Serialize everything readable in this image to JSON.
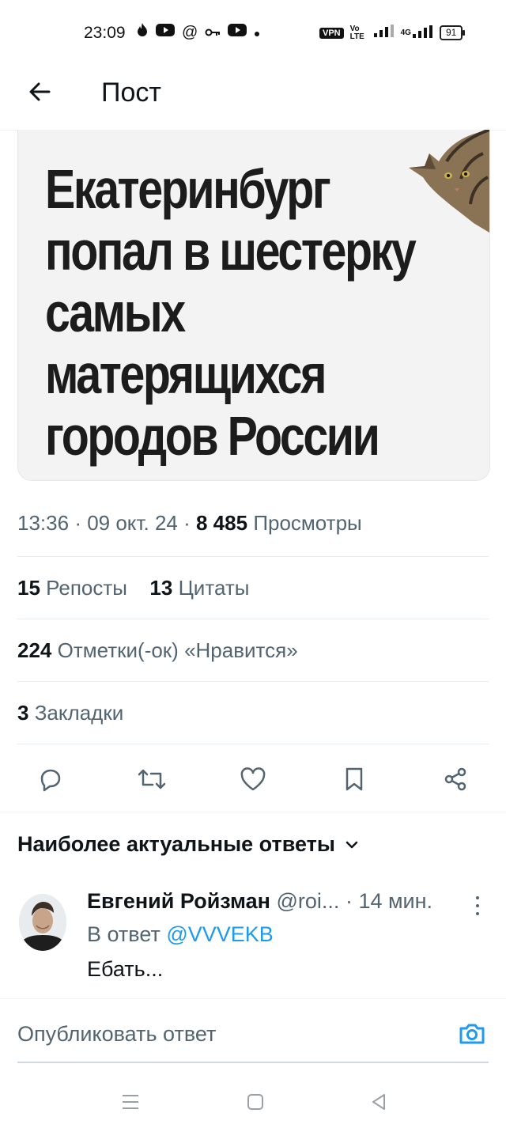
{
  "status_bar": {
    "time": "23:09",
    "vpn": "VPN",
    "volte": "Vo LTE",
    "net": "4G",
    "battery": "91"
  },
  "header": {
    "title": "Пост"
  },
  "post": {
    "headline_lines": [
      "Екатеринбург",
      "попал в шестерку",
      "самых",
      "матерящихся",
      "городов России"
    ],
    "time": "13:36",
    "date": "09 окт. 24",
    "views_count": "8 485",
    "views_label": "Просмотры",
    "reposts_count": "15",
    "reposts_label": "Репосты",
    "quotes_count": "13",
    "quotes_label": "Цитаты",
    "likes_count": "224",
    "likes_label": "Отметки(-ок) «Нравится»",
    "bookmarks_count": "3",
    "bookmarks_label": "Закладки"
  },
  "actions": {
    "icons": [
      "reply-icon",
      "repost-icon",
      "like-icon",
      "bookmark-icon",
      "share-icon"
    ]
  },
  "replies": {
    "sort_label": "Наиболее актуальные ответы",
    "items": [
      {
        "name": "Евгений Ройзман",
        "handle": "@roi...",
        "age": "14 мин.",
        "reply_to_prefix": "В ответ",
        "reply_to": "@VVVEKB",
        "text": "Ебать..."
      }
    ]
  },
  "composer": {
    "placeholder": "Опубликовать ответ"
  },
  "colors": {
    "accent": "#1d9bf0",
    "text": "#0f1419",
    "muted": "#536471"
  }
}
